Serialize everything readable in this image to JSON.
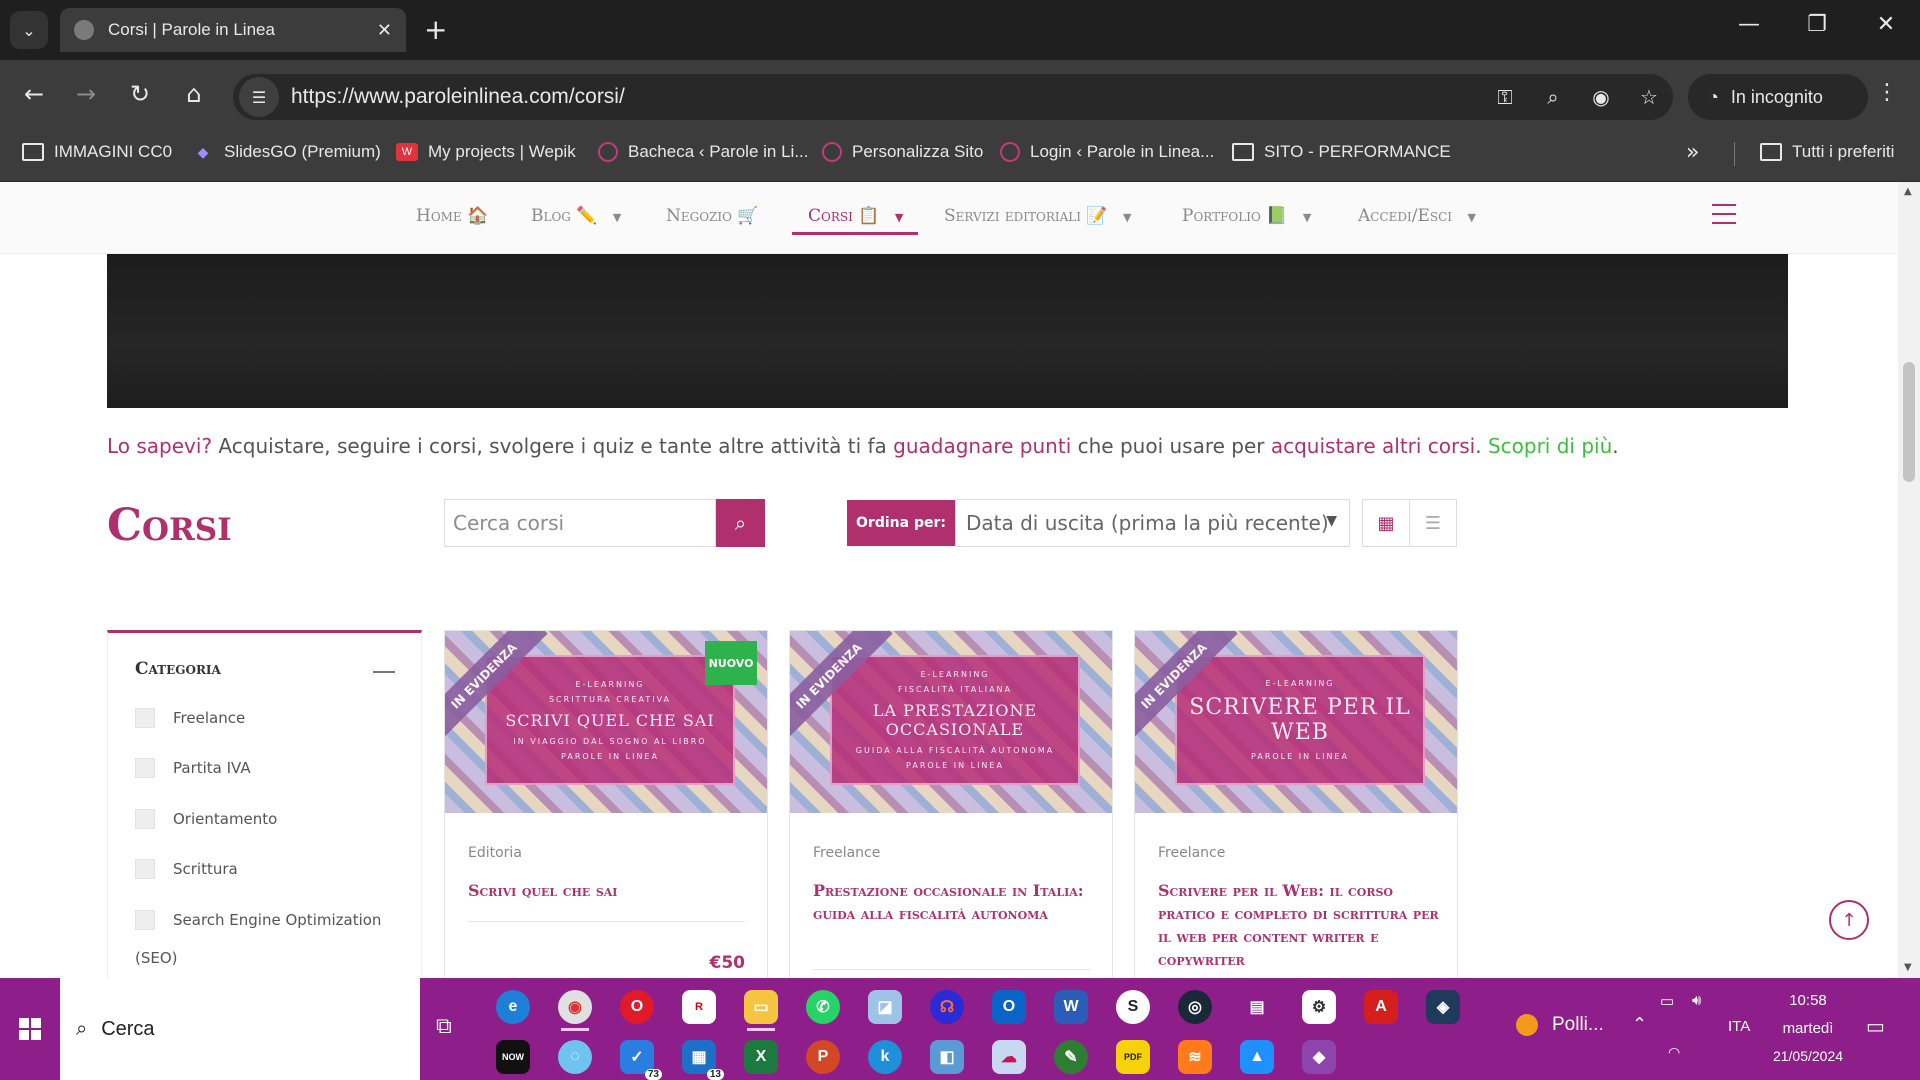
{
  "browser": {
    "tab_title": "Corsi | Parole in Linea",
    "url": "https://www.paroleinlinea.com/corsi/",
    "incognito_label": "In incognito",
    "bookmarks": [
      {
        "label": "IMMAGINI CC0",
        "icon": "folder-icon"
      },
      {
        "label": "SlidesGO (Premium)",
        "icon": "slidesgo-icon"
      },
      {
        "label": "My projects | Wepik",
        "icon": "wepik-icon"
      },
      {
        "label": "Bacheca ‹ Parole in Li...",
        "icon": "site-icon"
      },
      {
        "label": "Personalizza Sito",
        "icon": "site-icon"
      },
      {
        "label": "Login ‹ Parole in Linea...",
        "icon": "site-icon"
      },
      {
        "label": "SITO - PERFORMANCE",
        "icon": "folder-icon"
      }
    ],
    "all_bookmarks_label": "Tutti i preferiti"
  },
  "site_nav": {
    "items": [
      {
        "label": "Home",
        "emoji": "🏠",
        "has_dropdown": false
      },
      {
        "label": "Blog",
        "emoji": "✏️",
        "has_dropdown": true
      },
      {
        "label": "Negozio",
        "emoji": "🛒",
        "has_dropdown": false
      },
      {
        "label": "Corsi",
        "emoji": "📋",
        "has_dropdown": true,
        "active": true
      },
      {
        "label": "Servizi editoriali",
        "emoji": "📝",
        "has_dropdown": true
      },
      {
        "label": "Portfolio",
        "emoji": "📗",
        "has_dropdown": true
      },
      {
        "label": "Accedi/Esci",
        "emoji": "",
        "has_dropdown": true
      }
    ]
  },
  "info_banner": {
    "q": "Lo sapevi?",
    "t1": " Acquistare, seguire i corsi, svolgere i quiz e tante altre attività ti fa ",
    "h1": "guadagnare punti",
    "t2": " che puoi usare per ",
    "h2": "acquistare altri corsi",
    "t3": ". ",
    "link": "Scopri di più",
    "t4": "."
  },
  "courses_page": {
    "heading": "Corsi",
    "search_placeholder": "Cerca corsi",
    "order_label": "Ordina per:",
    "order_value": "Data di uscita (prima la più recente)"
  },
  "sidebar": {
    "title": "Categoria",
    "categories": [
      "Freelance",
      "Partita IVA",
      "Orientamento",
      "Scrittura",
      "Search Engine Optimization",
      "(SEO)"
    ]
  },
  "courses": [
    {
      "category": "Editoria",
      "title": "Scrivi quel che sai",
      "price": "€50",
      "featured_label": "IN EVIDENZA",
      "new_label": "NUOVO",
      "thumb": {
        "top": "E-LEARNING",
        "sub": "SCRITTURA CREATIVA",
        "main": "SCRIVI QUEL CHE SAI",
        "desc": "IN VIAGGIO DAL SOGNO AL LIBRO",
        "brand": "PAROLE IN LINEA"
      }
    },
    {
      "category": "Freelance",
      "title": "Prestazione occasionale in Italia: guida alla fiscalità autonoma",
      "featured_label": "IN EVIDENZA",
      "thumb": {
        "top": "E-LEARNING",
        "sub": "FISCALITÀ ITALIANA",
        "main": "LA PRESTAZIONE OCCASIONALE",
        "desc": "GUIDA ALLA FISCALITÀ AUTONOMA",
        "brand": "PAROLE IN LINEA"
      }
    },
    {
      "category": "Freelance",
      "title": "Scrivere per il Web: il corso pratico e completo di scrittura per il web per content writer e copywriter",
      "featured_label": "IN EVIDENZA",
      "thumb": {
        "top": "E-LEARNING",
        "main": "SCRIVERE PER IL WEB",
        "brand": "PAROLE IN LINEA"
      }
    }
  ],
  "taskbar": {
    "search_placeholder": "Cerca",
    "weather": "Polli...",
    "lang": "ITA",
    "time": "10:58",
    "day": "martedì",
    "date": "21/05/2024",
    "badges": {
      "todo": "73",
      "teams": "13"
    }
  },
  "colors": {
    "brand": "#b0306e",
    "green": "#3cc03c",
    "taskbar": "#8e1f8a"
  }
}
